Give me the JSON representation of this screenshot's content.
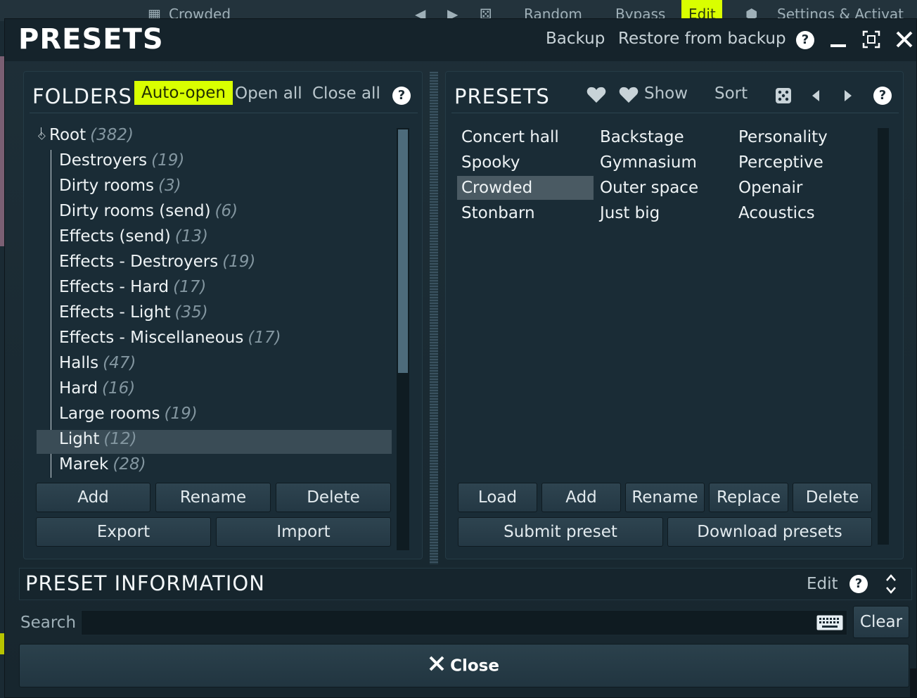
{
  "background_strip": {
    "items": [
      "Crowded",
      "Random",
      "Bypass",
      "Settings & Activat"
    ],
    "edit_label": "Edit"
  },
  "dialog": {
    "title": "PRESETS",
    "backup_label": "Backup",
    "restore_label": "Restore from backup",
    "help_label": "?"
  },
  "folders": {
    "title": "FOLDERS",
    "auto_open_label": "Auto-open",
    "open_all_label": "Open all",
    "close_all_label": "Close all",
    "help_label": "?",
    "root": {
      "name": "Root",
      "count": "(382)"
    },
    "items": [
      {
        "name": "Destroyers",
        "count": "(19)"
      },
      {
        "name": "Dirty rooms",
        "count": "(3)"
      },
      {
        "name": "Dirty rooms (send)",
        "count": "(6)"
      },
      {
        "name": "Effects (send)",
        "count": "(13)"
      },
      {
        "name": "Effects - Destroyers",
        "count": "(19)"
      },
      {
        "name": "Effects - Hard",
        "count": "(17)"
      },
      {
        "name": "Effects - Light",
        "count": "(35)"
      },
      {
        "name": "Effects - Miscellaneous",
        "count": "(17)"
      },
      {
        "name": "Halls",
        "count": "(47)"
      },
      {
        "name": "Hard",
        "count": "(16)"
      },
      {
        "name": "Large rooms",
        "count": "(19)"
      },
      {
        "name": "Light",
        "count": "(12)"
      },
      {
        "name": "Marek",
        "count": "(28)"
      }
    ],
    "add_label": "Add",
    "rename_label": "Rename",
    "delete_label": "Delete",
    "export_label": "Export",
    "import_label": "Import"
  },
  "presets": {
    "title": "PRESETS",
    "show_label": "Show",
    "sort_label": "Sort",
    "help_label": "?",
    "columns": [
      [
        "Concert hall",
        "Spooky",
        "Crowded",
        "Stonbarn"
      ],
      [
        "Backstage",
        "Gymnasium",
        "Outer space",
        "Just big"
      ],
      [
        "Personality",
        "Perceptive",
        "Openair",
        "Acoustics"
      ]
    ],
    "load_label": "Load",
    "add_label": "Add",
    "rename_label": "Rename",
    "replace_label": "Replace",
    "delete_label": "Delete",
    "submit_label": "Submit preset",
    "download_label": "Download presets"
  },
  "preset_info": {
    "title": "PRESET INFORMATION",
    "edit_label": "Edit",
    "help_label": "?"
  },
  "search": {
    "label": "Search",
    "value": "",
    "clear_label": "Clear"
  },
  "close_label": "Close",
  "colors": {
    "accent": "#d9ff00",
    "background": "#1a2a33",
    "selected": "#3a4c56"
  }
}
